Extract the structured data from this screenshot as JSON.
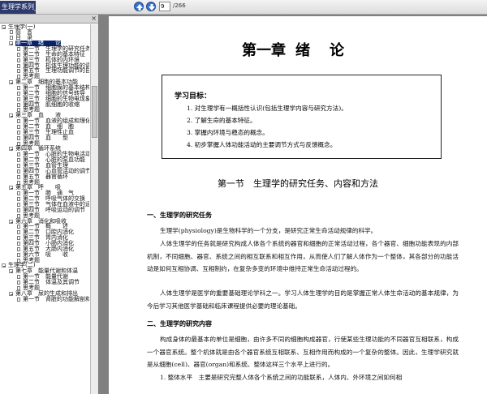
{
  "toolbar": {
    "app_tab": "生理学系列_文字版",
    "page_value": "9",
    "page_total": "/266"
  },
  "sidebar": {
    "close": "×",
    "rows": [
      {
        "level": 0,
        "toggle": "minus",
        "text": "生理学(一)"
      },
      {
        "level": 1,
        "toggle": "none",
        "text": "前　言"
      },
      {
        "level": 1,
        "toggle": "none",
        "text": "目　录"
      },
      {
        "level": 1,
        "toggle": "minus",
        "text": "第一章　绪　　论",
        "selected": true
      },
      {
        "level": 2,
        "toggle": "none",
        "text": "第一节　生理学的研究任务"
      },
      {
        "level": 2,
        "toggle": "none",
        "text": "第二节　生命的基本特征"
      },
      {
        "level": 2,
        "toggle": "none",
        "text": "第三节　机体的内环境"
      },
      {
        "level": 2,
        "toggle": "none",
        "text": "第四节　机体生理功能的调"
      },
      {
        "level": 2,
        "toggle": "none",
        "text": "第五节　生理功能调节的自"
      },
      {
        "level": 2,
        "toggle": "none",
        "text": "思考题"
      },
      {
        "level": 1,
        "toggle": "minus",
        "text": "第二章　细胞的基本功能"
      },
      {
        "level": 2,
        "toggle": "none",
        "text": "第一节　细胞膜的基本结构"
      },
      {
        "level": 2,
        "toggle": "none",
        "text": "第二节　细胞的信号转导"
      },
      {
        "level": 2,
        "toggle": "none",
        "text": "第三节　细胞的生物电现象"
      },
      {
        "level": 2,
        "toggle": "none",
        "text": "第四节　肌细胞的收缩"
      },
      {
        "level": 2,
        "toggle": "none",
        "text": "思考题"
      },
      {
        "level": 1,
        "toggle": "minus",
        "text": "第三章　血　　液"
      },
      {
        "level": 2,
        "toggle": "none",
        "text": "第一节　血液的组成和理化"
      },
      {
        "level": 2,
        "toggle": "none",
        "text": "第二节　血　细　胞"
      },
      {
        "level": 2,
        "toggle": "none",
        "text": "第三节　生理性止血"
      },
      {
        "level": 2,
        "toggle": "none",
        "text": "第四节　血　　型"
      },
      {
        "level": 2,
        "toggle": "none",
        "text": "思考题"
      },
      {
        "level": 1,
        "toggle": "minus",
        "text": "第四章　循环系统"
      },
      {
        "level": 2,
        "toggle": "none",
        "text": "第一节　心脏的生物电活动"
      },
      {
        "level": 2,
        "toggle": "none",
        "text": "第二节　心脏的泵血功能"
      },
      {
        "level": 2,
        "toggle": "none",
        "text": "第三节　血管生理"
      },
      {
        "level": 2,
        "toggle": "none",
        "text": "第四节　心血管活动的调节"
      },
      {
        "level": 2,
        "toggle": "none",
        "text": "第五节　器官循环"
      },
      {
        "level": 2,
        "toggle": "none",
        "text": "思考题"
      },
      {
        "level": 1,
        "toggle": "minus",
        "text": "第五章　呼　　吸"
      },
      {
        "level": 2,
        "toggle": "none",
        "text": "第一节　肺　通　气"
      },
      {
        "level": 2,
        "toggle": "none",
        "text": "第二节　呼吸气体的交换"
      },
      {
        "level": 2,
        "toggle": "none",
        "text": "第三节　气体在血液中的运"
      },
      {
        "level": 2,
        "toggle": "none",
        "text": "第四节　呼吸运动的调节"
      },
      {
        "level": 2,
        "toggle": "none",
        "text": "思考题"
      },
      {
        "level": 1,
        "toggle": "minus",
        "text": "第六章　消化和吸收"
      },
      {
        "level": 2,
        "toggle": "none",
        "text": "第一节　概　　述"
      },
      {
        "level": 2,
        "toggle": "none",
        "text": "第二节　口腔内消化"
      },
      {
        "level": 2,
        "toggle": "none",
        "text": "第三节　胃内消化"
      },
      {
        "level": 2,
        "toggle": "none",
        "text": "第四节　小肠内消化"
      },
      {
        "level": 2,
        "toggle": "none",
        "text": "第五节　大肠内消化"
      },
      {
        "level": 2,
        "toggle": "none",
        "text": "第六节　吸　　收"
      },
      {
        "level": 2,
        "toggle": "none",
        "text": "思考题"
      },
      {
        "level": 0,
        "toggle": "minus",
        "text": "生理学(二)"
      },
      {
        "level": 1,
        "toggle": "minus",
        "text": "第七章　能量代谢和体温"
      },
      {
        "level": 2,
        "toggle": "none",
        "text": "第一节　能量代谢"
      },
      {
        "level": 2,
        "toggle": "none",
        "text": "第二节　体温及其调节"
      },
      {
        "level": 2,
        "toggle": "none",
        "text": "思考题"
      },
      {
        "level": 1,
        "toggle": "minus",
        "text": "第八章　尿的生成和排出"
      },
      {
        "level": 2,
        "toggle": "none",
        "text": "第一节　肾脏的功能解剖和"
      }
    ]
  },
  "doc": {
    "chapter": {
      "a": "第一章",
      "b": "绪",
      "c": "论"
    },
    "goals_heading": "学习目标：",
    "goals": [
      "1.  对生理学有一概括性认识(包括生理学内容与研究方法)。",
      "2.  了解生命的基本特征。",
      "3.  掌握内环境与稳态的概念。",
      "4.  初步掌握人体功能活动的主要调节方式与反馈概念。"
    ],
    "section_title": "第一节　生理学的研究任务、内容和方法",
    "sub1": "一、生理学的研究任务",
    "sub2": "二、生理学的研究内容",
    "p1": "生理学(physiology)是生物科学的一个分支，是研究正常生命活动规律的科学。",
    "p2": "人体生理学的任务就是研究构成人体各个系统的器官和细胞的正常活动过程，各个器官、细胞功能表现的内部机制，不同细胞、器官、系统之间的相互联系和相互作用，从而使人们了解人体作为一个整体，其各部分的功能活动是如何互相协调、互相制约，在复杂多变的环境中维持正常生命活动过程的。",
    "p3": "人体生理学是医学的重要基础理论学科之一。学习人体生理学的目的是掌握正常人体生命活动的基本规律，为今后学习其他医学基础和临床课程提供必要的理论基础。",
    "p4": "构成身体的最基本的单位是细胞，由许多不同的细胞构成器官，行使某些生理功能的不同器官互相联系，构成一个器官系统。整个机体就是由各个器官系统互相联系、互相作用而构成的一个复杂的整体。因此，生理学研究就是从细胞(cell)、器官(organ)和系统、整体这样三个水平上进行的。",
    "p5": "1. 整体水平　主要是研究完整人体各个系统之间的功能联系，人体内、外环境之间如何相"
  }
}
